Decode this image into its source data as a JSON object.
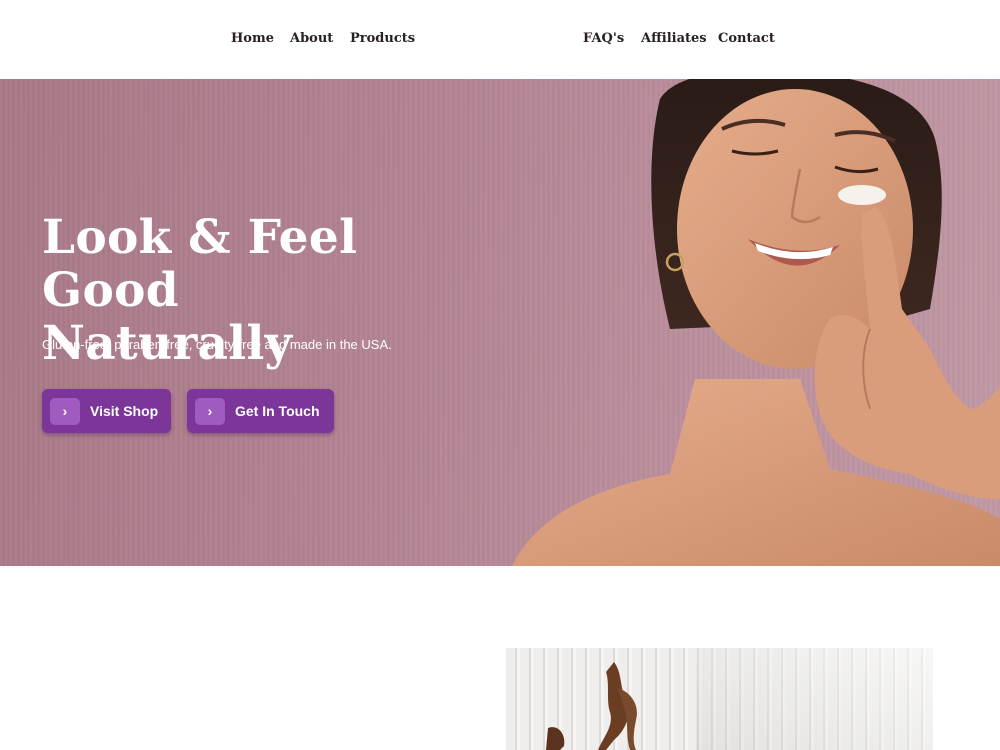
{
  "nav": {
    "left": [
      "Home",
      "About",
      "Products"
    ],
    "right": [
      "FAQ's",
      "Affiliates",
      "Contact"
    ]
  },
  "hero": {
    "title_line1": "Look & Feel Good",
    "title_line2": "Naturally",
    "subtitle": "Gluten-free, paraben-free, cruelty-free and made in the USA.",
    "buttons": [
      {
        "label": "Visit Shop",
        "icon": "chevron-right-icon"
      },
      {
        "label": "Get In Touch",
        "icon": "chevron-right-icon"
      }
    ]
  },
  "colors": {
    "hero_bg": "#b38494",
    "button": "#7c3599",
    "button_icon": "#a05bbf",
    "nav_text": "#2a2024"
  }
}
